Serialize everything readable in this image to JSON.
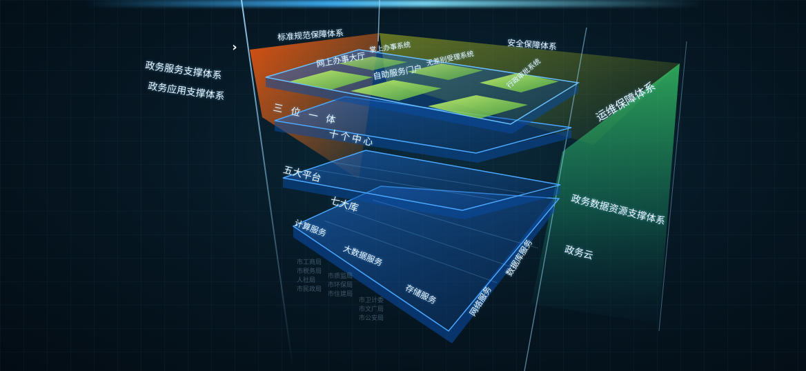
{
  "labels": {
    "biaozhun": "标准规范保障体系",
    "anquan": "安全保障体系",
    "yunwei": "运维保障体系",
    "zwfwzc": "政务服务支撑体系",
    "zwyyzc": "政务应用支撑体系",
    "wangshang": "网上办事大厅",
    "zhangshang": "掌上办事系统",
    "zizhu": "自助服务门户",
    "wuchabie": "无差别受理系统",
    "xingzheng": "行政审批系统",
    "sanwei": "三位一体",
    "shige": "十个中心",
    "wuda": "五大平台",
    "qida": "七大库",
    "zwsjzy": "政务数据资源支撑体系",
    "zwy": "政务云",
    "jisuan": "计算服务",
    "dashuju": "大数据服务",
    "cunchu": "存储服务",
    "wangluo": "网络服务",
    "shujuku": "数据库服务"
  },
  "colors": {
    "accent": "#2f8dff",
    "orange": "#ff6a1a",
    "yellow": "#d9d81f",
    "green": "#33d16a",
    "module": "#b8f070"
  },
  "icons": {
    "next": "›"
  }
}
